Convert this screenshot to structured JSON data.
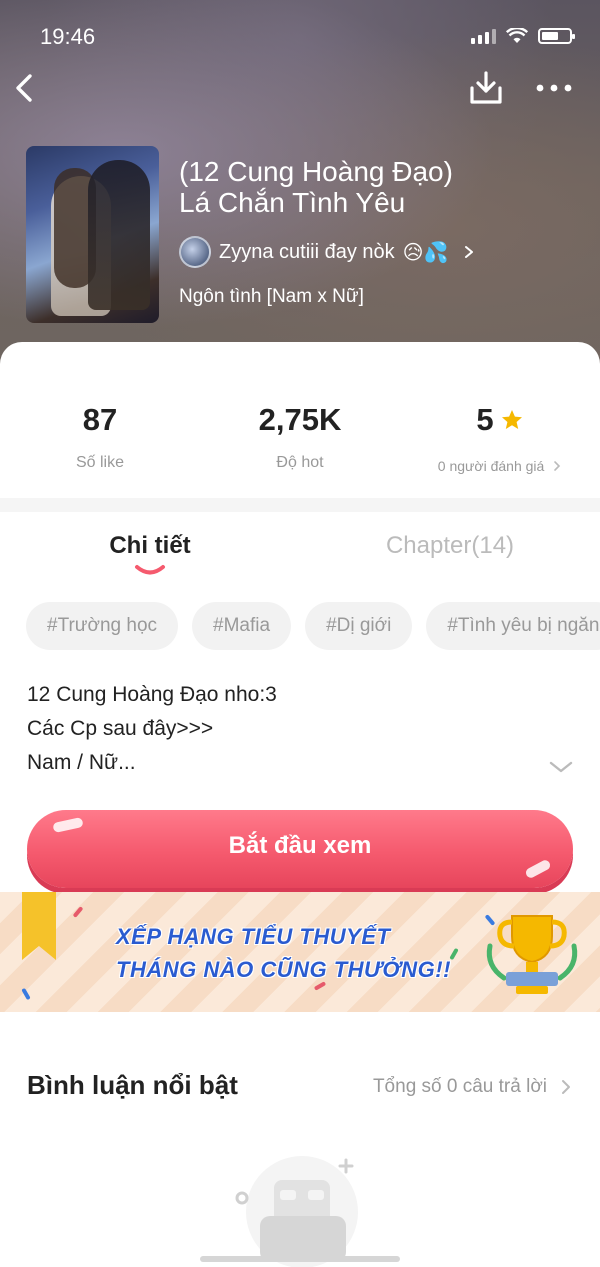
{
  "status_bar": {
    "time": "19:46"
  },
  "header": {
    "back_icon": "chevron-left-icon",
    "download_icon": "download-icon",
    "more_icon": "more-horizontal-icon"
  },
  "book": {
    "title_line1": "(12 Cung Hoàng Đạo)",
    "title_line2": "Lá Chắn Tình Yêu",
    "author": "Zyyna cutiii đay nòk",
    "author_emoji": "😥💦",
    "genre": "Ngôn tình [Nam x Nữ]"
  },
  "stats": [
    {
      "value": "87",
      "label": "Số like"
    },
    {
      "value": "2,75K",
      "label": "Độ hot"
    },
    {
      "value": "5",
      "label": "0 người đánh giá"
    }
  ],
  "tabs": {
    "detail": "Chi tiết",
    "chapter": "Chapter(14)"
  },
  "tags": [
    "#Trường học",
    "#Mafia",
    "#Dị giới",
    "#Tình yêu bị ngăn"
  ],
  "description": {
    "line1": "12 Cung Hoàng Đạo nho:3",
    "line2": "Các Cp sau đây>>>",
    "line3": "Nam / Nữ..."
  },
  "start_button": "Bắt đầu xem",
  "banner": {
    "line1": "XẾP HẠNG TIỂU THUYẾT",
    "line2": "THÁNG NÀO CŨNG THƯỞNG!!"
  },
  "comments": {
    "title": "Bình luận nổi bật",
    "count_text": "Tổng số 0 câu trả lời"
  },
  "colors": {
    "accent": "#f55a6e",
    "banner_text": "#2a5bd0",
    "star": "#f5b800",
    "muted": "#999999"
  }
}
